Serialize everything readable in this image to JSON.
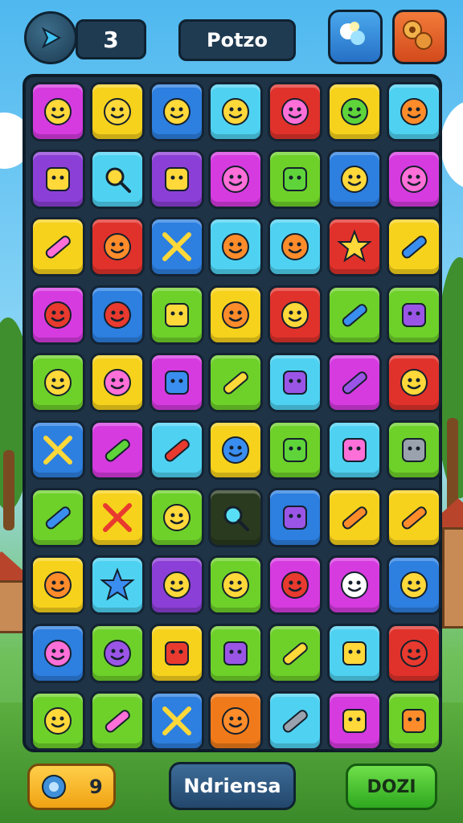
{
  "header": {
    "level_value": "3",
    "title": "Potzo",
    "play_icon": "play-arrow-icon",
    "left_corner_icon": "bubbles-icon",
    "right_corner_icon": "cookies-icon"
  },
  "footer": {
    "coin_count": "9",
    "coin_icon": "gear-coin-icon",
    "middle_label": "Ndriensa",
    "right_label": "DOZI"
  },
  "palette": {
    "magenta": "#d63be0",
    "yellow": "#f7d21c",
    "blue": "#2d7fe0",
    "cyan": "#4fd2f2",
    "red": "#e0322b",
    "green": "#6ed12a",
    "purple": "#8c3fd6",
    "orange": "#f07a1a",
    "dark": "#2a3a1e"
  },
  "board": {
    "rows": [
      [
        {
          "bg": "magenta",
          "icon": "yellow-face-icon"
        },
        {
          "bg": "yellow",
          "icon": "yellow-bird-icon"
        },
        {
          "bg": "blue",
          "icon": "yellow-sun-face-icon"
        },
        {
          "bg": "cyan",
          "icon": "yellow-smile-icon"
        },
        {
          "bg": "red",
          "icon": "pink-bug-icon"
        },
        {
          "bg": "yellow",
          "icon": "green-pear-face-icon"
        },
        {
          "bg": "cyan",
          "icon": "orange-bulb-icon"
        }
      ],
      [
        {
          "bg": "purple",
          "icon": "camera-icon"
        },
        {
          "bg": "cyan",
          "icon": "magnifier-icon"
        },
        {
          "bg": "purple",
          "icon": "robot-box-icon"
        },
        {
          "bg": "magenta",
          "icon": "pink-blob-icon"
        },
        {
          "bg": "green",
          "icon": "green-cube-icon"
        },
        {
          "bg": "blue",
          "icon": "stone-icon"
        },
        {
          "bg": "magenta",
          "icon": "pink-ring-icon"
        }
      ],
      [
        {
          "bg": "yellow",
          "icon": "pink-crayon-icon"
        },
        {
          "bg": "red",
          "icon": "orange-ball-icon"
        },
        {
          "bg": "blue",
          "icon": "crossed-tools-icon"
        },
        {
          "bg": "cyan",
          "icon": "orange-smile-icon"
        },
        {
          "bg": "cyan",
          "icon": "orange-fish-icon"
        },
        {
          "bg": "red",
          "icon": "yellow-star-icon"
        },
        {
          "bg": "yellow",
          "icon": "blue-pencil-icon"
        }
      ],
      [
        {
          "bg": "magenta",
          "icon": "red-blob-icon"
        },
        {
          "bg": "blue",
          "icon": "red-tomato-icon"
        },
        {
          "bg": "green",
          "icon": "yellow-box-face-icon"
        },
        {
          "bg": "yellow",
          "icon": "orange-sun-icon"
        },
        {
          "bg": "red",
          "icon": "yellow-face-icon"
        },
        {
          "bg": "green",
          "icon": "blue-flashlight-icon"
        },
        {
          "bg": "green",
          "icon": "purple-radio-icon"
        }
      ],
      [
        {
          "bg": "green",
          "icon": "yellow-sun-face-icon"
        },
        {
          "bg": "yellow",
          "icon": "pink-cat-face-icon"
        },
        {
          "bg": "magenta",
          "icon": "blue-screen-icon"
        },
        {
          "bg": "green",
          "icon": "telescope-icon"
        },
        {
          "bg": "cyan",
          "icon": "purple-crystal-icon"
        },
        {
          "bg": "magenta",
          "icon": "purple-capsule-icon"
        },
        {
          "bg": "red",
          "icon": "yellow-rocket-icon"
        }
      ],
      [
        {
          "bg": "blue",
          "icon": "crossed-arrows-icon"
        },
        {
          "bg": "magenta",
          "icon": "green-wand-icon"
        },
        {
          "bg": "cyan",
          "icon": "red-screwdriver-icon"
        },
        {
          "bg": "yellow",
          "icon": "blue-bottle-icon"
        },
        {
          "bg": "green",
          "icon": "green-bag-icon"
        },
        {
          "bg": "cyan",
          "icon": "pink-jar-icon"
        },
        {
          "bg": "green",
          "icon": "gray-robot-icon"
        }
      ],
      [
        {
          "bg": "green",
          "icon": "blue-stick-icon"
        },
        {
          "bg": "yellow",
          "icon": "red-cross-icon"
        },
        {
          "bg": "green",
          "icon": "yellow-face-icon"
        },
        {
          "bg": "dark",
          "icon": "cyan-magnifier-icon"
        },
        {
          "bg": "blue",
          "icon": "purple-backpack-icon"
        },
        {
          "bg": "yellow",
          "icon": "orange-hammer-icon"
        },
        {
          "bg": "yellow",
          "icon": "orange-trumpet-icon"
        }
      ],
      [
        {
          "bg": "yellow",
          "icon": "orange-lion-icon"
        },
        {
          "bg": "cyan",
          "icon": "blue-star-icon"
        },
        {
          "bg": "purple",
          "icon": "yellow-face-icon"
        },
        {
          "bg": "green",
          "icon": "yellow-wink-icon"
        },
        {
          "bg": "magenta",
          "icon": "red-tomato-icon"
        },
        {
          "bg": "magenta",
          "icon": "white-ghost-icon"
        },
        {
          "bg": "blue",
          "icon": "yellow-bird-icon"
        }
      ],
      [
        {
          "bg": "blue",
          "icon": "pink-cat-face-icon"
        },
        {
          "bg": "green",
          "icon": "purple-alien-icon"
        },
        {
          "bg": "yellow",
          "icon": "red-tag-icon"
        },
        {
          "bg": "green",
          "icon": "purple-phone-icon"
        },
        {
          "bg": "green",
          "icon": "yellow-hammer-icon"
        },
        {
          "bg": "cyan",
          "icon": "picture-frame-icon"
        },
        {
          "bg": "red",
          "icon": "red-balloon-icon"
        }
      ],
      [
        {
          "bg": "green",
          "icon": "yellow-sun-face-icon"
        },
        {
          "bg": "green",
          "icon": "pink-marker-icon"
        },
        {
          "bg": "blue",
          "icon": "yellow-cross-icon"
        },
        {
          "bg": "orange",
          "icon": "orange-sandal-icon"
        },
        {
          "bg": "cyan",
          "icon": "gray-pipe-icon"
        },
        {
          "bg": "magenta",
          "icon": "yellow-card-icon"
        },
        {
          "bg": "green",
          "icon": "orange-book-icon"
        }
      ]
    ]
  }
}
